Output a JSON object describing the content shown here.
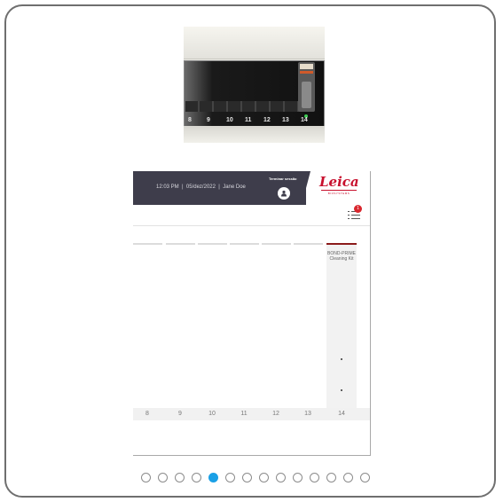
{
  "instrument": {
    "slot_numbers": [
      "8",
      "9",
      "10",
      "11",
      "12",
      "13",
      "14"
    ]
  },
  "screen": {
    "header": {
      "time": "12:03 PM",
      "date": "05/dez/2022",
      "user": "Jane Doe",
      "terminar_label": "Terminar sessão",
      "notification_count": "1"
    },
    "logo": {
      "brand": "Leica",
      "sub": "BIOSYSTEMS"
    },
    "column14_label_line1": "BOND-PRIME",
    "column14_label_line2": "Cleaning Kit",
    "column_numbers": [
      "8",
      "9",
      "10",
      "11",
      "12",
      "13",
      "14"
    ]
  },
  "pagination": {
    "total": 14,
    "active_index": 4
  },
  "colors": {
    "accent": "#1aa0e6",
    "brand": "#c8102e",
    "topbar": "#3e3d4b",
    "active_tab": "#8b1a1a"
  }
}
